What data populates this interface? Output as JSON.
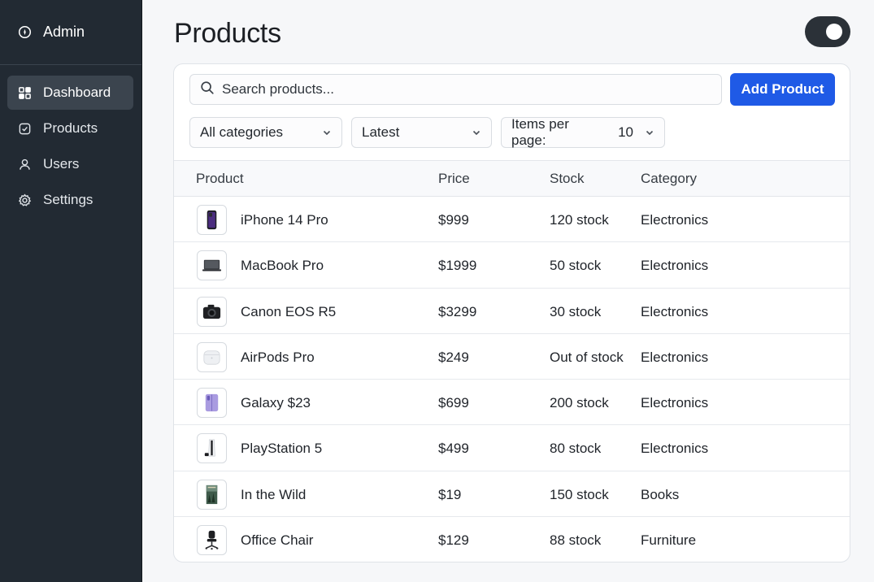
{
  "sidebar": {
    "brand": {
      "icon": "compass-icon",
      "label": "Admin"
    },
    "items": [
      {
        "icon": "dashboard-icon",
        "label": "Dashboard",
        "active": true
      },
      {
        "icon": "products-icon",
        "label": "Products",
        "active": false
      },
      {
        "icon": "users-icon",
        "label": "Users",
        "active": false
      },
      {
        "icon": "settings-icon",
        "label": "Settings",
        "active": false
      }
    ]
  },
  "header": {
    "title": "Products",
    "theme_toggle": {
      "state": "on"
    }
  },
  "toolbar": {
    "search_placeholder": "Search products...",
    "add_label": "Add Product",
    "accent_color": "#1f5ae6",
    "category_filter": "All categories",
    "sort_filter": "Latest",
    "per_page_label": "Items per page:",
    "per_page_value": "10"
  },
  "table": {
    "columns": [
      "Product",
      "Price",
      "Stock",
      "Category"
    ],
    "rows": [
      {
        "thumb": "phone-icon",
        "name": "iPhone 14 Pro",
        "price": "$999",
        "stock": "120 stock",
        "category": "Electronics"
      },
      {
        "thumb": "laptop-icon",
        "name": "MacBook Pro",
        "price": "$1999",
        "stock": "50 stock",
        "category": "Electronics"
      },
      {
        "thumb": "camera-icon",
        "name": "Canon EOS R5",
        "price": "$3299",
        "stock": "30 stock",
        "category": "Electronics"
      },
      {
        "thumb": "earbuds-case-icon",
        "name": "AirPods Pro",
        "price": "$249",
        "stock": "Out of stock",
        "category": "Electronics"
      },
      {
        "thumb": "foldable-phone-icon",
        "name": "Galaxy $23",
        "price": "$699",
        "stock": "200 stock",
        "category": "Electronics"
      },
      {
        "thumb": "console-icon",
        "name": "PlayStation 5",
        "price": "$499",
        "stock": "80 stock",
        "category": "Electronics"
      },
      {
        "thumb": "book-cover-icon",
        "name": "In the Wild",
        "price": "$19",
        "stock": "150 stock",
        "category": "Books"
      },
      {
        "thumb": "office-chair-icon",
        "name": "Office Chair",
        "price": "$129",
        "stock": "88 stock",
        "category": "Furniture"
      }
    ]
  }
}
